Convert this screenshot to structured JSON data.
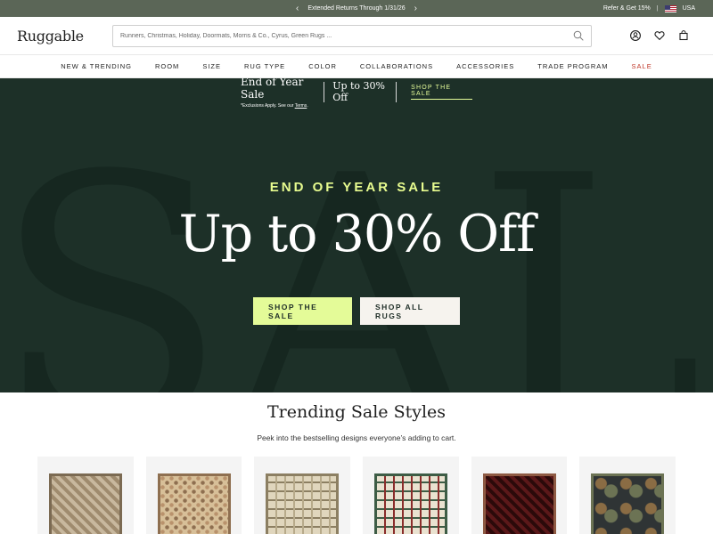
{
  "announcement": {
    "text": "Extended Returns Through 1/31/26",
    "prev": "‹",
    "next": "›"
  },
  "account": {
    "refer": "Refer & Get 15%",
    "divider": "|",
    "country": "USA"
  },
  "header": {
    "logo": "Ruggable",
    "search_placeholder": "Runners, Christmas, Holiday, Doormats, Morris & Co., Cyrus, Green Rugs ..."
  },
  "nav": {
    "items": [
      "NEW & TRENDING",
      "ROOM",
      "SIZE",
      "RUG TYPE",
      "COLOR",
      "COLLABORATIONS",
      "ACCESSORIES",
      "TRADE PROGRAM",
      "SALE"
    ]
  },
  "hero": {
    "background_text": "SALE",
    "banner": {
      "title": "End of Year Sale",
      "terms_prefix": "*Exclusions Apply. See our ",
      "terms_link": "Terms",
      "terms_suffix": ".",
      "offer": "Up to 30% Off",
      "shop": "SHOP THE SALE"
    },
    "eyebrow": "END OF YEAR SALE",
    "headline": "Up to 30% Off",
    "buttons": {
      "shop_sale": "SHOP THE SALE",
      "shop_all": "SHOP ALL RUGS"
    }
  },
  "trending": {
    "title": "Trending Sale Styles",
    "subtitle": "Peek into the bestselling designs everyone’s adding to cart."
  },
  "colors": {
    "topbar": "#5b6657",
    "hero": "#1d3028",
    "accent": "#e4fb98",
    "sale": "#c0392b"
  },
  "products": [
    {
      "name": "tan-medallion-rug",
      "colors": [
        "#c8b89e",
        "#9f8b6e",
        "#7b6a52"
      ]
    },
    {
      "name": "leopard-rug",
      "colors": [
        "#d7bf98",
        "#b9926c",
        "#8e6f50"
      ]
    },
    {
      "name": "plaid-beige-rug",
      "colors": [
        "#e0d6bd",
        "#b7aa8a",
        "#8c7f62"
      ]
    },
    {
      "name": "red-plaid-rug",
      "colors": [
        "#e9e2d0",
        "#8a2d2b",
        "#3d5c45"
      ]
    },
    {
      "name": "dark-red-rug",
      "colors": [
        "#5b1819",
        "#2b0a0a",
        "#8e5a43"
      ]
    },
    {
      "name": "floral-dark-rug",
      "colors": [
        "#2f3435",
        "#8a6c44",
        "#6c7354"
      ]
    }
  ]
}
